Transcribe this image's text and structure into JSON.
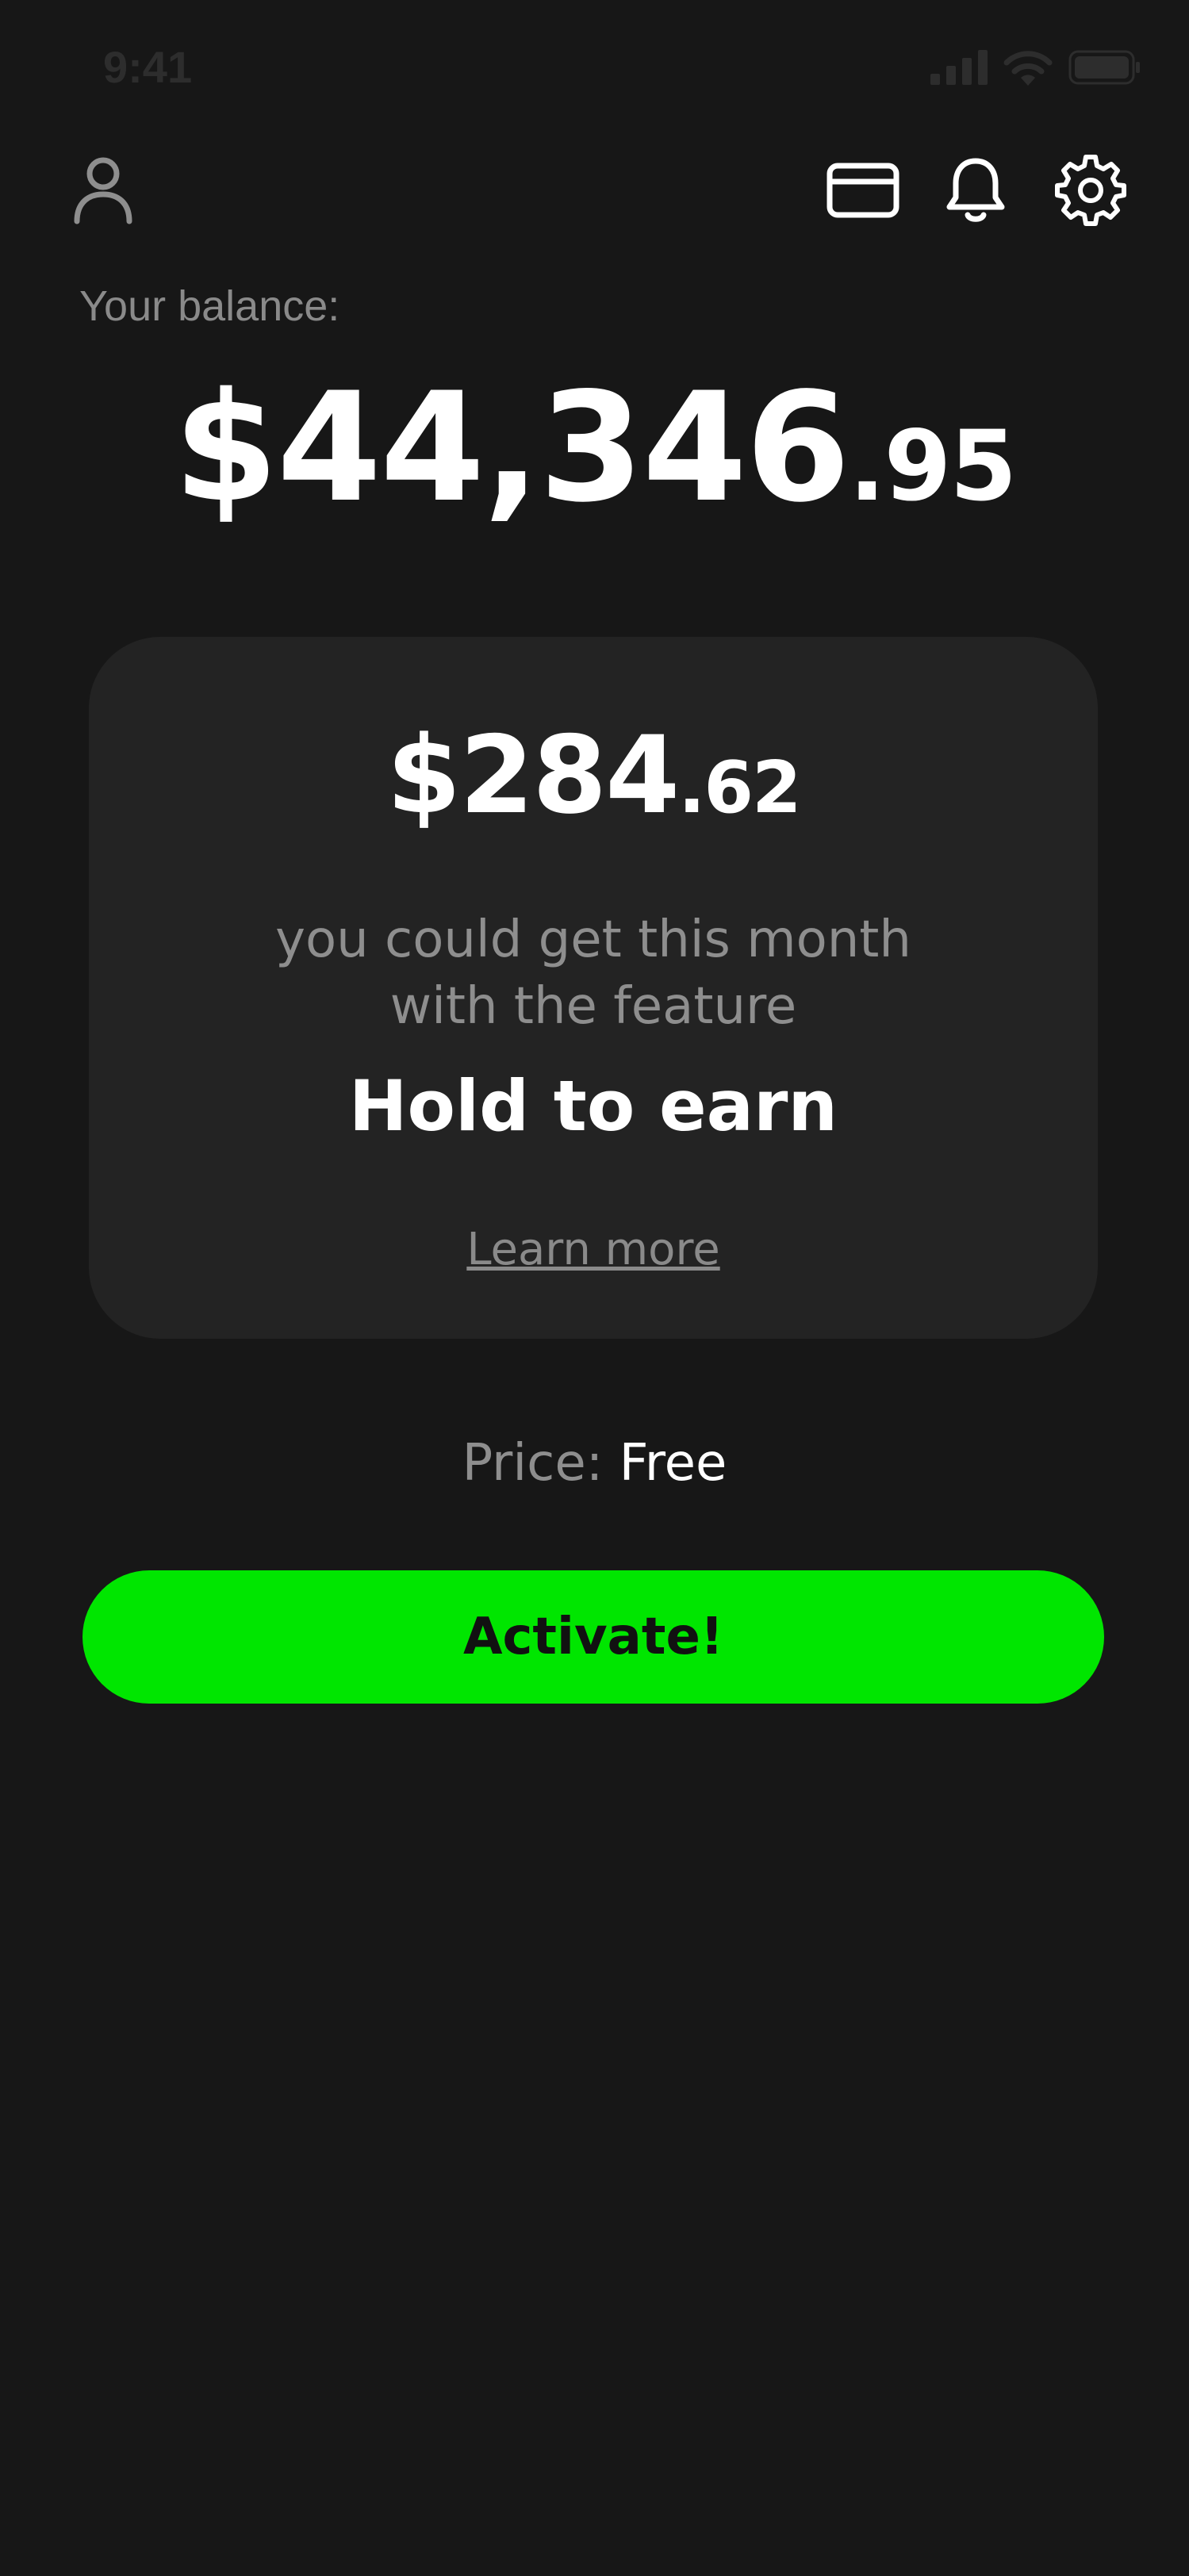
{
  "status_bar": {
    "time": "9:41",
    "icons": [
      "signal-icon",
      "wifi-icon",
      "battery-icon"
    ]
  },
  "top_bar": {
    "icons": [
      "profile-icon",
      "card-icon",
      "bell-icon",
      "gear-icon"
    ]
  },
  "balance": {
    "label": "Your balance:",
    "whole": "$44,346",
    "cents": ".95"
  },
  "feature_card": {
    "amount_whole": "$284",
    "amount_cents": ".62",
    "description_line1": "you could get this month",
    "description_line2": "with the feature",
    "feature_name": "Hold to earn",
    "learn_more": "Learn more"
  },
  "price": {
    "label": "Price:",
    "value": "Free"
  },
  "activate_button": {
    "label": "Activate!"
  },
  "colors": {
    "background": "#171717",
    "card": "#232323",
    "accent": "#00e600",
    "muted_text": "#8e8e8e"
  }
}
